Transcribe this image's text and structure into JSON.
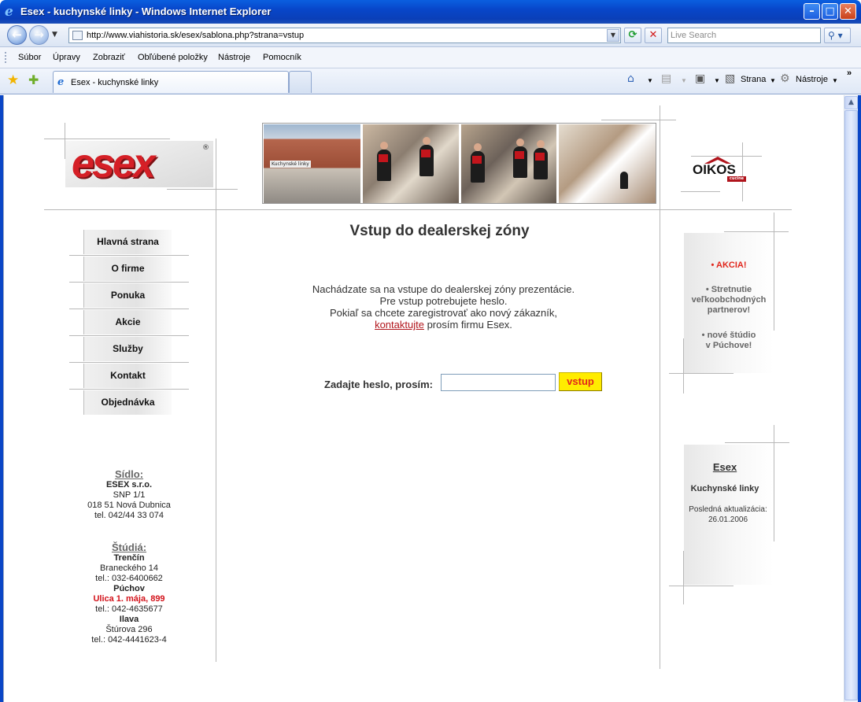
{
  "window": {
    "title": "Esex - kuchynské linky - Windows Internet Explorer",
    "minimize": "–",
    "maximize": "□",
    "close": "✕"
  },
  "address_bar": {
    "url": "http://www.viahistoria.sk/esex/sablona.php?strana=vstup",
    "search_placeholder": "Live Search"
  },
  "menu": [
    "Súbor",
    "Úpravy",
    "Zobraziť",
    "Obľúbené položky",
    "Nástroje",
    "Pomocník"
  ],
  "tab": {
    "label": "Esex - kuchynské linky"
  },
  "commands": {
    "page": "Strana",
    "tools": "Nástroje"
  },
  "icons": {
    "back": "back-arrow-icon",
    "forward": "forward-arrow-icon",
    "refresh": "refresh-icon",
    "stop": "stop-icon",
    "search": "search-icon",
    "favorites": "favorites-star-icon",
    "add_favorite": "add-favorite-icon",
    "home": "home-icon",
    "feeds": "rss-feed-icon",
    "print": "print-icon",
    "page": "page-icon",
    "tools": "gear-icon"
  },
  "page": {
    "logo_text": "esex",
    "logo_mark": "®",
    "photo_sign": "Kuchynské linky",
    "oikos_logo": "OIKOS",
    "oikos_sub": "cucine",
    "heading": "Vstup do dealerskej zóny",
    "intro_line1": "Nachádzate sa na vstupe do dealerskej zóny prezentácie.",
    "intro_line2": "Pre vstup potrebujete heslo.",
    "intro_line3": "Pokiaľ sa chcete zaregistrovať ako nový zákazník,",
    "intro_link": "kontaktujte",
    "intro_rest": " prosím firmu Esex.",
    "password_label": "Zadajte heslo, prosím:",
    "password_value": "",
    "submit_label": "vstup"
  },
  "nav": [
    "Hlavná strana",
    "O firme",
    "Ponuka",
    "Akcie",
    "Služby",
    "Kontakt",
    "Objednávka"
  ],
  "seat": {
    "heading": "Sídlo:",
    "company": "ESEX s.r.o.",
    "street": "SNP 1/1",
    "city": "018 51 Nová Dubnica",
    "phone": "tel. 042/44 33 074"
  },
  "studios": {
    "heading": "Štúdiá:",
    "items": [
      {
        "city": "Trenčín",
        "street": "Braneckého 14",
        "phone": "tel.: 032-6400662"
      },
      {
        "city": "Púchov",
        "street": "Ulica 1. mája, 899",
        "phone": "tel.: 042-4635677"
      },
      {
        "city": "Ilava",
        "street": "Štúrova 296",
        "phone": "tel.: 042-4441623-4"
      }
    ]
  },
  "sidebar_news": {
    "item1": "AKCIA!",
    "item2_l1": "• Stretnutie",
    "item2_l2": "veľkoobchodných",
    "item2_l3": "partnerov!",
    "item3_l1": "• nové štúdio",
    "item3_l2": "v Púchove!"
  },
  "sidebar_info": {
    "title": "Esex",
    "subtitle": "Kuchynské linky",
    "update_label": "Posledná aktualizácia:",
    "update_date": "26.01.2006"
  }
}
